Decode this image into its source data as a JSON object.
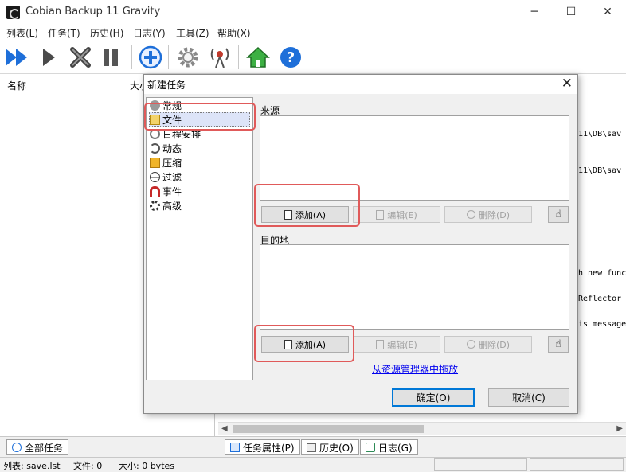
{
  "window": {
    "title": "Cobian Backup 11 Gravity",
    "min_glyph": "─",
    "max_glyph": "☐",
    "close_glyph": "✕"
  },
  "menu": [
    "列表(L)",
    "任务(T)",
    "历史(H)",
    "日志(Y)",
    "工具(Z)",
    "帮助(X)"
  ],
  "task_list": {
    "col_name": "名称",
    "col_size": "大小"
  },
  "log_lines": [
    "11\\DB\\sav",
    "11\\DB\\sav",
    "h new func",
    "Reflector",
    "is message"
  ],
  "bottom_tabs": {
    "all_tasks": "全部任务",
    "task_properties": "任务属性(P)",
    "history": "历史(O)",
    "log": "日志(G)"
  },
  "status": {
    "list": "列表: save.lst",
    "files": "文件: 0",
    "size": "大小: 0 bytes"
  },
  "dialog": {
    "title": "新建任务",
    "close_glyph": "✕",
    "tree": [
      "常规",
      "文件",
      "日程安排",
      "动态",
      "压缩",
      "过滤",
      "事件",
      "高级"
    ],
    "selected_tree_item": "文件",
    "source_label": "来源",
    "destination_label": "目的地",
    "add_label": "添加(A)",
    "edit_label": "编辑(E)",
    "delete_label": "删除(D)",
    "link_label": "从资源管理器中拖放",
    "ok_label": "确定(O)",
    "cancel_label": "取消(C)"
  },
  "colors": {
    "accent": "#0078d7",
    "highlight_box": "#e05a5a",
    "toolbar_blue": "#1e6fd9"
  },
  "icons": [
    "run-all-icon",
    "run-icon",
    "stop-icon",
    "pause-icon",
    "new-task-icon",
    "settings-icon",
    "antenna-icon",
    "home-icon",
    "help-icon"
  ]
}
